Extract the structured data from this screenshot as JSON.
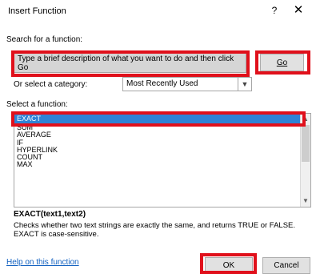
{
  "window": {
    "title": "Insert Function",
    "help_glyph": "?",
    "close_glyph": "✕"
  },
  "search": {
    "label": "Search for a function:",
    "value": "Type a brief description of what you want to do and then click Go",
    "go_label": "Go"
  },
  "category": {
    "label": "Or select a category:",
    "selected": "Most Recently Used"
  },
  "functions": {
    "label": "Select a function:",
    "items": [
      "EXACT",
      "SUM",
      "AVERAGE",
      "IF",
      "HYPERLINK",
      "COUNT",
      "MAX"
    ],
    "selected_index": 0
  },
  "details": {
    "signature": "EXACT(text1,text2)",
    "description": "Checks whether two text strings are exactly the same, and returns TRUE or FALSE. EXACT is case-sensitive."
  },
  "footer": {
    "help_link": "Help on this function",
    "ok_label": "OK",
    "cancel_label": "Cancel"
  },
  "colors": {
    "highlight": "#e0101b",
    "selection": "#2f83d6",
    "link": "#1060c0"
  },
  "icons": [
    "question-mark-icon",
    "close-icon",
    "chevron-down-icon",
    "scroll-up-arrow-icon",
    "scroll-down-arrow-icon"
  ]
}
